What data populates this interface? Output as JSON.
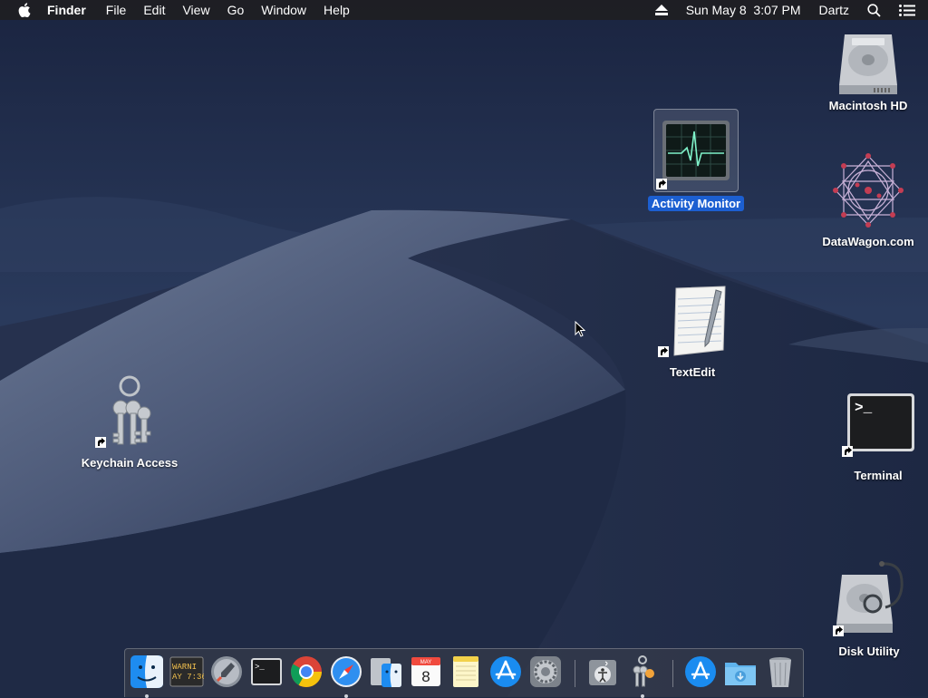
{
  "menubar": {
    "app_name": "Finder",
    "items": [
      "File",
      "Edit",
      "View",
      "Go",
      "Window",
      "Help"
    ],
    "clock": "Sun May 8  3:07 PM",
    "user": "Dartz",
    "icons": [
      "apple-icon",
      "eject-icon",
      "spotlight-search-icon",
      "notification-center-icon"
    ]
  },
  "desktop": {
    "icons": [
      {
        "name": "Macintosh HD",
        "icon": "hard-drive-icon",
        "alias": false,
        "selected": false
      },
      {
        "name": "Activity Monitor",
        "icon": "activity-monitor-icon",
        "alias": true,
        "selected": true
      },
      {
        "name": "DataWagon.com",
        "icon": "datawagon-icon",
        "alias": false,
        "selected": false
      },
      {
        "name": "TextEdit",
        "icon": "textedit-icon",
        "alias": true,
        "selected": false
      },
      {
        "name": "Keychain Access",
        "icon": "keychain-icon",
        "alias": true,
        "selected": false
      },
      {
        "name": "Terminal",
        "icon": "terminal-icon",
        "alias": true,
        "selected": false
      },
      {
        "name": "Disk Utility",
        "icon": "disk-utility-icon",
        "alias": true,
        "selected": false
      }
    ],
    "terminal_prompt": ">_"
  },
  "dock": {
    "items": [
      {
        "name": "Finder",
        "icon": "finder-icon",
        "running": true
      },
      {
        "name": "Console",
        "icon": "console-icon",
        "running": false,
        "text_line1": "WARNI",
        "text_line2": "AY 7:36"
      },
      {
        "name": "Launchpad",
        "icon": "launchpad-icon",
        "running": false
      },
      {
        "name": "Terminal",
        "icon": "terminal-icon",
        "running": false,
        "text": ">_"
      },
      {
        "name": "Google Chrome",
        "icon": "chrome-icon",
        "running": false
      },
      {
        "name": "Safari",
        "icon": "safari-icon",
        "running": true
      },
      {
        "name": "Migration Assistant",
        "icon": "migration-assistant-icon",
        "running": false
      },
      {
        "name": "Calendar",
        "icon": "calendar-icon",
        "running": false,
        "month": "MAY",
        "day": "8"
      },
      {
        "name": "Notes",
        "icon": "notes-icon",
        "running": false
      },
      {
        "name": "App Store",
        "icon": "app-store-icon",
        "running": false
      },
      {
        "name": "System Preferences",
        "icon": "system-preferences-icon",
        "running": false
      },
      {
        "name": "VoiceOver Utility",
        "icon": "voiceover-utility-icon",
        "running": false
      },
      {
        "name": "Keychain Access",
        "icon": "keychain-icon",
        "running": true
      },
      {
        "name": "Applications",
        "icon": "applications-folder-icon",
        "running": false
      },
      {
        "name": "Downloads",
        "icon": "downloads-folder-icon",
        "running": false
      },
      {
        "name": "Trash",
        "icon": "trash-icon",
        "running": false
      }
    ]
  },
  "colors": {
    "selection": "#1c5fd1",
    "menubar": "#1e1e22",
    "sky_top": "#1b2540",
    "dune": "#5a6a88"
  }
}
